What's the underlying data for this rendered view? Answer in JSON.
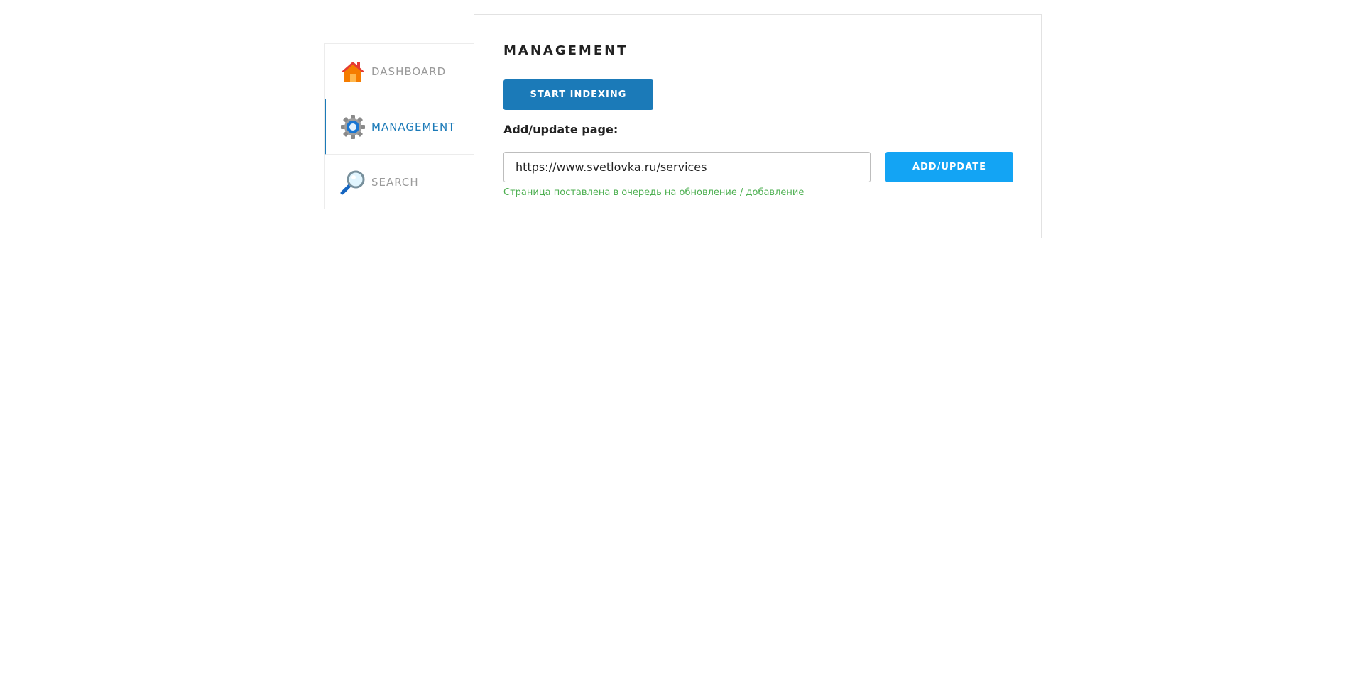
{
  "sidebar": {
    "items": [
      {
        "label": "DASHBOARD",
        "icon": "home-icon",
        "active": false
      },
      {
        "label": "MANAGEMENT",
        "icon": "gear-icon",
        "active": true
      },
      {
        "label": "SEARCH",
        "icon": "magnifier-icon",
        "active": false
      }
    ]
  },
  "panel": {
    "title": "MANAGEMENT",
    "start_button_label": "START INDEXING",
    "field_label": "Add/update page:",
    "url_value": "https://www.svetlovka.ru/services",
    "add_button_label": "ADD/UPDATE",
    "status_message": "Страница поставлена в очередь на обновление / добавление"
  },
  "colors": {
    "accent_dark": "#1b7ab8",
    "accent_light": "#13a4f4",
    "success": "#4caf50",
    "muted": "#9a9a9a"
  }
}
